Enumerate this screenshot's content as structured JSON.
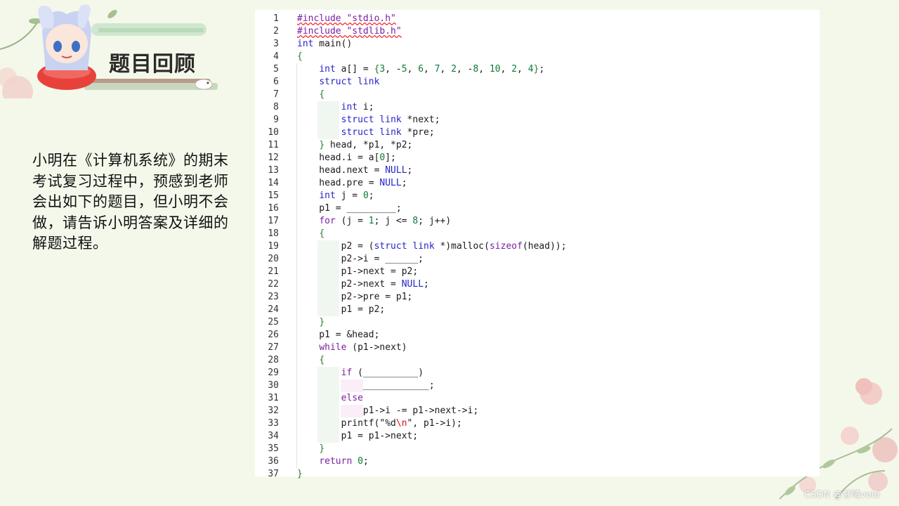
{
  "slide": {
    "title": "题目回顾",
    "description": "小明在《计算机系统》的期末考试复习过程中，预感到老师会出如下的题目，但小明不会做，请告诉小明答案及详细的解题过程。",
    "watermark": "CSDN @甘晴void"
  },
  "code": {
    "language": "c",
    "lines": [
      {
        "n": "1",
        "text": "#include \"stdio.h\""
      },
      {
        "n": "2",
        "text": "#include \"stdlib.h\""
      },
      {
        "n": "3",
        "text": "int main()"
      },
      {
        "n": "4",
        "text": "{"
      },
      {
        "n": "5",
        "text": "    int a[] = {3, -5, 6, 7, 2, -8, 10, 2, 4};"
      },
      {
        "n": "6",
        "text": "    struct link"
      },
      {
        "n": "7",
        "text": "    {"
      },
      {
        "n": "8",
        "text": "        int i;"
      },
      {
        "n": "9",
        "text": "        struct link *next;"
      },
      {
        "n": "10",
        "text": "        struct link *pre;"
      },
      {
        "n": "11",
        "text": "    } head, *p1, *p2;"
      },
      {
        "n": "12",
        "text": "    head.i = a[0];"
      },
      {
        "n": "13",
        "text": "    head.next = NULL;"
      },
      {
        "n": "14",
        "text": "    head.pre = NULL;"
      },
      {
        "n": "15",
        "text": "    int j = 0;"
      },
      {
        "n": "16",
        "text": "    p1 = _________;"
      },
      {
        "n": "17",
        "text": "    for (j = 1; j <= 8; j++)"
      },
      {
        "n": "18",
        "text": "    {"
      },
      {
        "n": "19",
        "text": "        p2 = (struct link *)malloc(sizeof(head));"
      },
      {
        "n": "20",
        "text": "        p2->i = ______;"
      },
      {
        "n": "21",
        "text": "        p1->next = p2;"
      },
      {
        "n": "22",
        "text": "        p2->next = NULL;"
      },
      {
        "n": "23",
        "text": "        p2->pre = p1;"
      },
      {
        "n": "24",
        "text": "        p1 = p2;"
      },
      {
        "n": "25",
        "text": "    }"
      },
      {
        "n": "26",
        "text": "    p1 = &head;"
      },
      {
        "n": "27",
        "text": "    while (p1->next)"
      },
      {
        "n": "28",
        "text": "    {"
      },
      {
        "n": "29",
        "text": "        if (__________)"
      },
      {
        "n": "30",
        "text": "            ____________;"
      },
      {
        "n": "31",
        "text": "        else"
      },
      {
        "n": "32",
        "text": "            p1->i -= p1->next->i;"
      },
      {
        "n": "33",
        "text": "        printf(\"%d\\n\", p1->i);"
      },
      {
        "n": "34",
        "text": "        p1 = p1->next;"
      },
      {
        "n": "35",
        "text": "    }"
      },
      {
        "n": "36",
        "text": "    return 0;"
      },
      {
        "n": "37",
        "text": "}"
      }
    ]
  },
  "colors": {
    "keyword": "#7a1fa2",
    "type": "#2424c8",
    "number": "#0b7a3a",
    "macro": "#7a1fa2",
    "escape": "#d11",
    "brace": "#2e7d32",
    "default": "#1a1a1a"
  }
}
